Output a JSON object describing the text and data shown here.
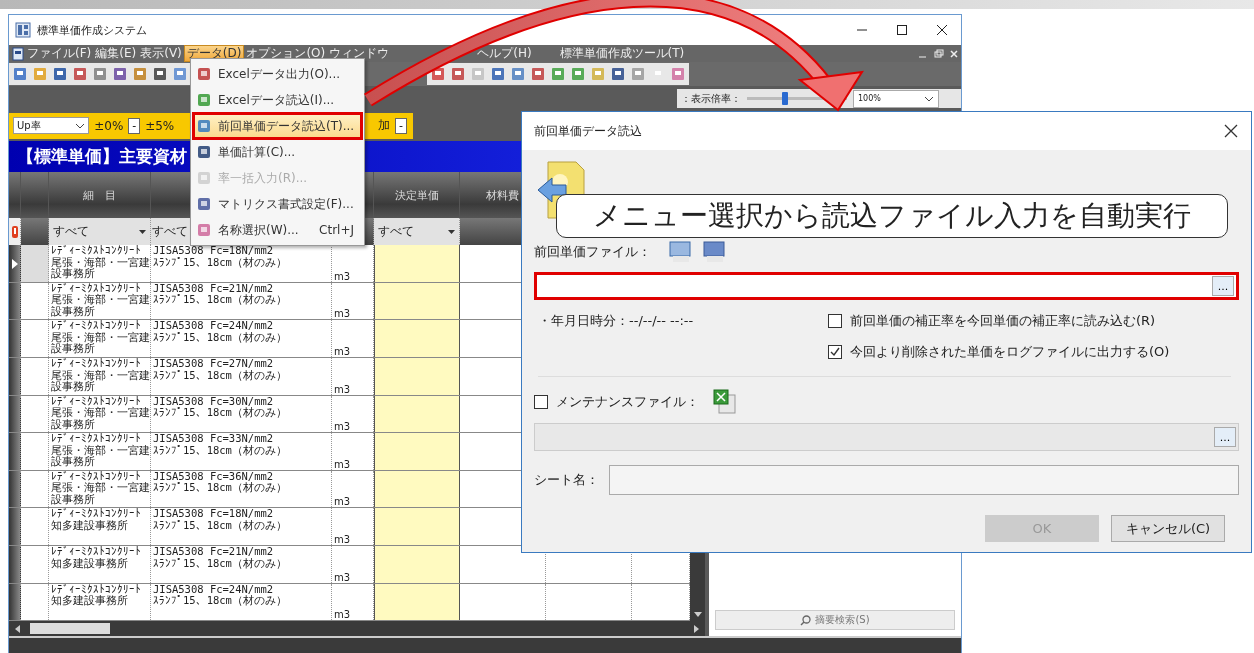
{
  "main_window": {
    "title": "標準単価作成システム",
    "menu": [
      {
        "label": "ファイル(F)",
        "selected": false
      },
      {
        "label": "編集(E)",
        "selected": false
      },
      {
        "label": "表示(V)",
        "selected": false
      },
      {
        "label": "データ(D)",
        "selected": true
      },
      {
        "label": "オプション(O)",
        "selected": false
      },
      {
        "label": "ウィンドウ",
        "selected": false
      },
      {
        "label": "ヘルプ(H)",
        "selected": false
      },
      {
        "label": "標準単価作成ツール(T)",
        "selected": false
      }
    ],
    "zoom": {
      "label": "：表示倍率：",
      "level": 0.35,
      "value": "100%"
    },
    "rate_toolbar": {
      "dropdown": "Up率",
      "items": [
        {
          "kind": "label",
          "text": "±0%"
        },
        {
          "kind": "button",
          "text": "-"
        },
        {
          "kind": "label",
          "text": "±5%"
        }
      ],
      "trailing": [
        {
          "kind": "label",
          "text": "加"
        },
        {
          "kind": "button",
          "text": "-"
        }
      ]
    },
    "sheet_title": "【標準単価】主要資材",
    "table": {
      "headers": {
        "name": "細　目",
        "price": "決定単価",
        "material": "材料費"
      },
      "filters": {
        "name": "すべて",
        "spec": "すべて",
        "price": "すべて"
      },
      "rows": [
        {
          "selected": true,
          "name": [
            "ﾚﾃﾞｨｰﾐｸｽﾄｺﾝｸﾘｰﾄ",
            "尾張・海部・一宮建設事務所"
          ],
          "spec": [
            "JISA5308 Fc=18N/mm2",
            "ｽﾗﾝﾌﾟ15、18cm（材のみ）"
          ],
          "unit": "m3"
        },
        {
          "selected": false,
          "name": [
            "ﾚﾃﾞｨｰﾐｸｽﾄｺﾝｸﾘｰﾄ",
            "尾張・海部・一宮建設事務所"
          ],
          "spec": [
            "JISA5308 Fc=21N/mm2",
            "ｽﾗﾝﾌﾟ15、18cm（材のみ）"
          ],
          "unit": "m3"
        },
        {
          "selected": false,
          "name": [
            "ﾚﾃﾞｨｰﾐｸｽﾄｺﾝｸﾘｰﾄ",
            "尾張・海部・一宮建設事務所"
          ],
          "spec": [
            "JISA5308 Fc=24N/mm2",
            "ｽﾗﾝﾌﾟ15、18cm（材のみ）"
          ],
          "unit": "m3"
        },
        {
          "selected": false,
          "name": [
            "ﾚﾃﾞｨｰﾐｸｽﾄｺﾝｸﾘｰﾄ",
            "尾張・海部・一宮建設事務所"
          ],
          "spec": [
            "JISA5308 Fc=27N/mm2",
            "ｽﾗﾝﾌﾟ15、18cm（材のみ）"
          ],
          "unit": "m3"
        },
        {
          "selected": false,
          "name": [
            "ﾚﾃﾞｨｰﾐｸｽﾄｺﾝｸﾘｰﾄ",
            "尾張・海部・一宮建設事務所"
          ],
          "spec": [
            "JISA5308 Fc=30N/mm2",
            "ｽﾗﾝﾌﾟ15、18cm（材のみ）"
          ],
          "unit": "m3"
        },
        {
          "selected": false,
          "name": [
            "ﾚﾃﾞｨｰﾐｸｽﾄｺﾝｸﾘｰﾄ",
            "尾張・海部・一宮建設事務所"
          ],
          "spec": [
            "JISA5308 Fc=33N/mm2",
            "ｽﾗﾝﾌﾟ15、18cm（材のみ）"
          ],
          "unit": "m3"
        },
        {
          "selected": false,
          "name": [
            "ﾚﾃﾞｨｰﾐｸｽﾄｺﾝｸﾘｰﾄ",
            "尾張・海部・一宮建設事務所"
          ],
          "spec": [
            "JISA5308 Fc=36N/mm2",
            "ｽﾗﾝﾌﾟ15、18cm（材のみ）"
          ],
          "unit": "m3"
        },
        {
          "selected": false,
          "name": [
            "ﾚﾃﾞｨｰﾐｸｽﾄｺﾝｸﾘｰﾄ",
            "知多建設事務所"
          ],
          "spec": [
            "JISA5308 Fc=18N/mm2",
            "ｽﾗﾝﾌﾟ15、18cm（材のみ）"
          ],
          "unit": "m3"
        },
        {
          "selected": false,
          "name": [
            "ﾚﾃﾞｨｰﾐｸｽﾄｺﾝｸﾘｰﾄ",
            "知多建設事務所"
          ],
          "spec": [
            "JISA5308 Fc=21N/mm2",
            "ｽﾗﾝﾌﾟ15、18cm（材のみ）"
          ],
          "unit": "m3"
        },
        {
          "selected": false,
          "name": [
            "ﾚﾃﾞｨｰﾐｸｽﾄｺﾝｸﾘｰﾄ",
            "知多建設事務所"
          ],
          "spec": [
            "JISA5308 Fc=24N/mm2",
            "ｽﾗﾝﾌﾟ15、18cm（材のみ）"
          ],
          "unit": "m3"
        }
      ]
    },
    "search_button": "摘要検索(S)"
  },
  "data_menu": {
    "items": [
      {
        "label": "Excelデータ出力(O)...",
        "disabled": false,
        "selected": false
      },
      {
        "label": "Excelデータ読込(I)...",
        "disabled": false,
        "selected": false
      },
      {
        "label": "前回単価データ読込(T)...",
        "disabled": false,
        "selected": true
      },
      {
        "label": "単価計算(C)...",
        "disabled": false,
        "selected": false
      },
      {
        "label": "率一括入力(R)...",
        "disabled": true,
        "selected": false
      },
      {
        "label": "マトリクス書式設定(F)...",
        "disabled": false,
        "selected": false
      },
      {
        "label": "名称選択(W)...",
        "shortcut": "Ctrl+J",
        "disabled": false,
        "selected": false
      }
    ]
  },
  "dialog": {
    "title": "前回単価データ読込",
    "file_label": "前回単価ファイル：",
    "file_field": {
      "highlighted": true,
      "browse": "..."
    },
    "timestamp": "・年月日時分：--/--/-- --:--",
    "options": [
      {
        "label": "前回単価の補正率を今回単価の補正率に読み込む(R)",
        "checked": false
      },
      {
        "label": "今回より削除された単価をログファイルに出力する(O)",
        "checked": true
      }
    ],
    "maintenance": {
      "label": "メンテナンスファイル：",
      "checked": false,
      "browse": "..."
    },
    "sheet_label": "シート名：",
    "buttons": [
      {
        "label": "OK",
        "disabled": true
      },
      {
        "label": "キャンセル(C)",
        "disabled": false
      }
    ]
  },
  "callout": "メニュー選択から読込ファイル入力を自動実行"
}
